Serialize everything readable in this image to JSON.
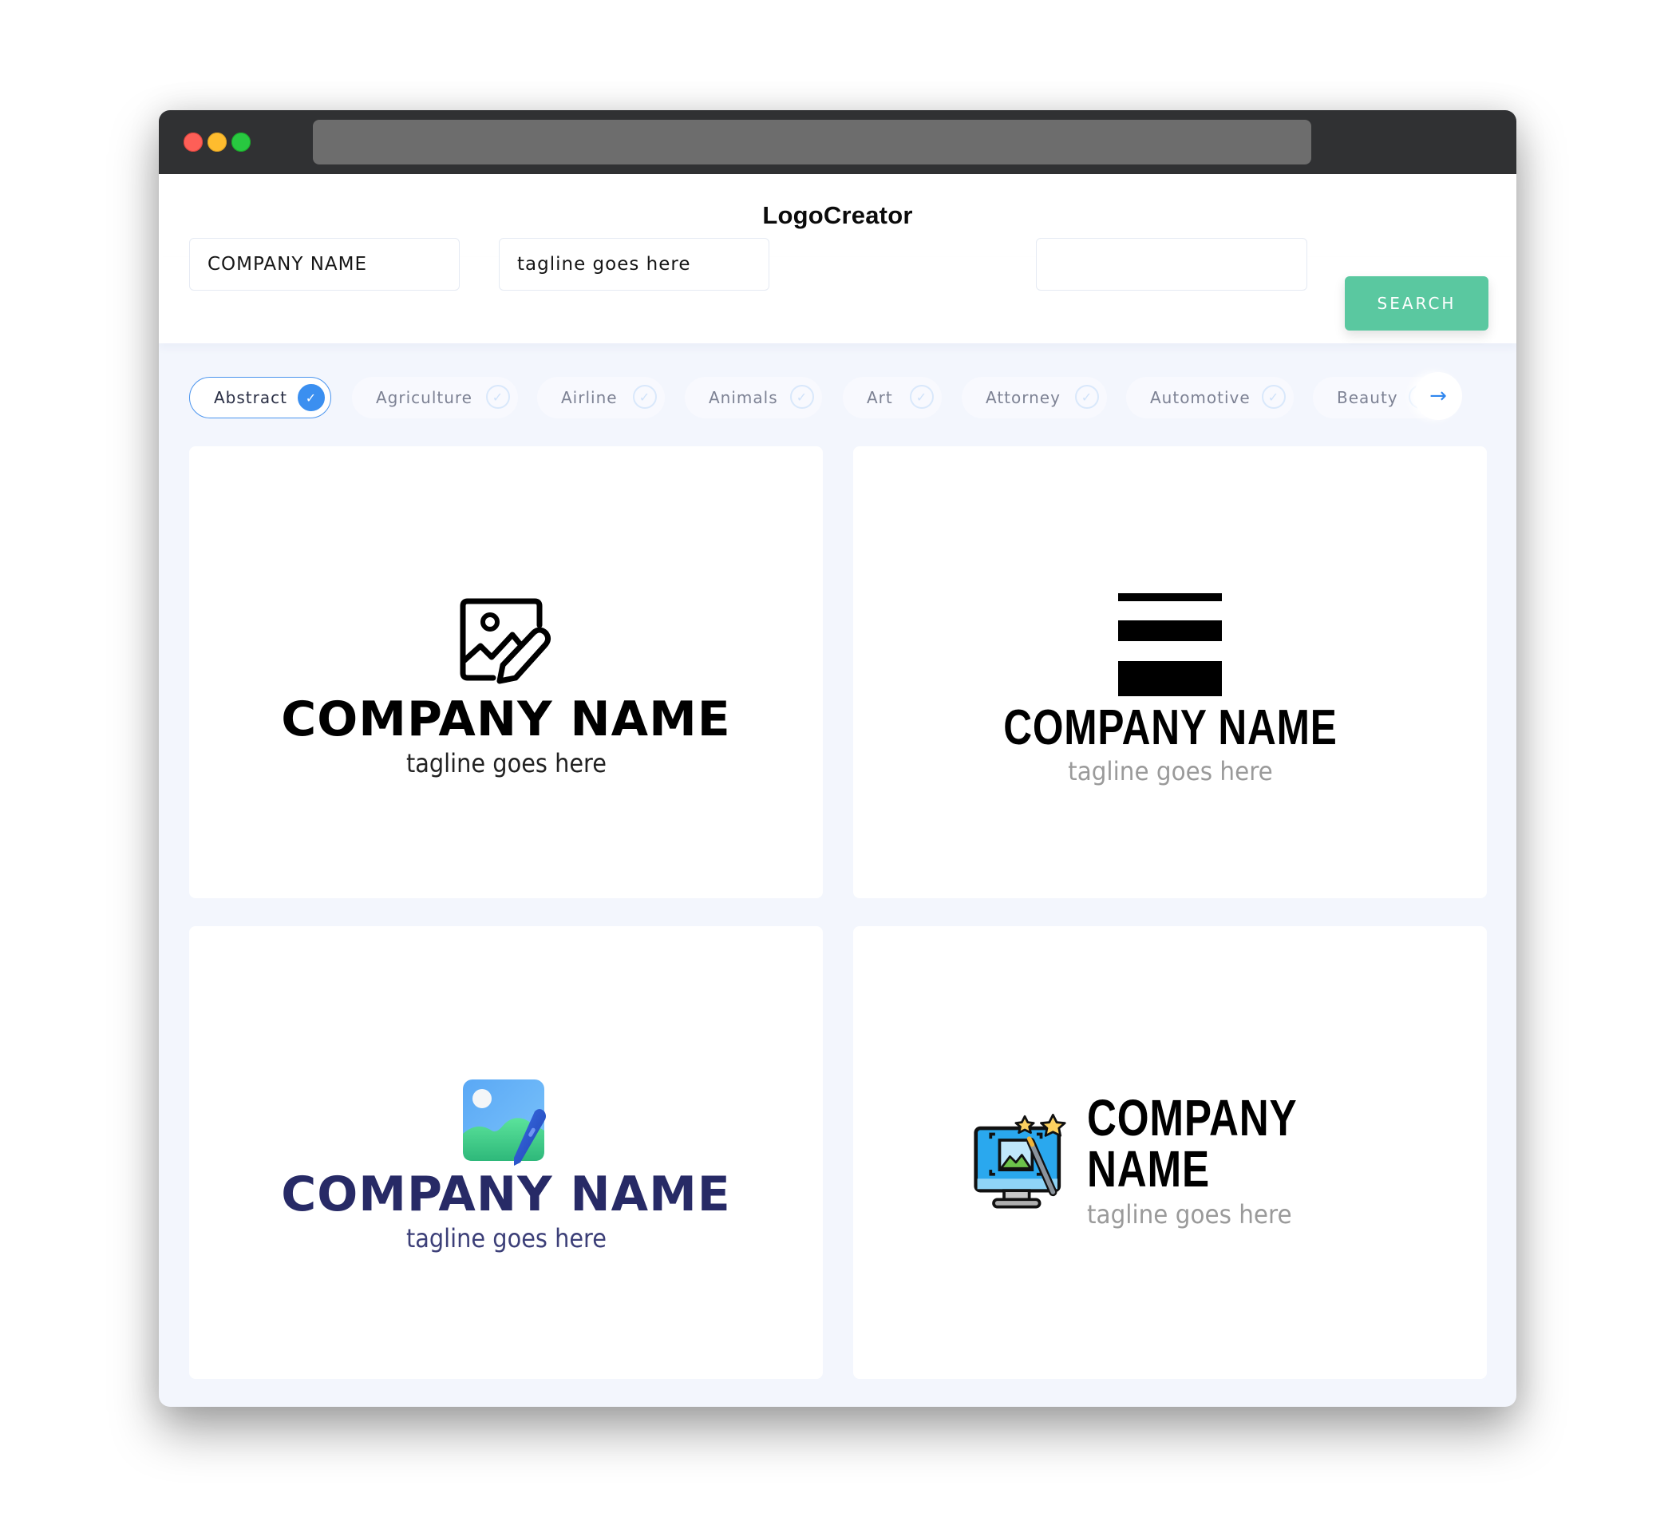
{
  "app": {
    "title": "LogoCreator"
  },
  "search": {
    "company_value": "COMPANY NAME",
    "tagline_value": "tagline goes here",
    "extra_value": "",
    "search_label": "SEARCH"
  },
  "categories": {
    "items": [
      {
        "label": "Abstract",
        "selected": true
      },
      {
        "label": "Agriculture",
        "selected": false
      },
      {
        "label": "Airline",
        "selected": false
      },
      {
        "label": "Animals",
        "selected": false
      },
      {
        "label": "Art",
        "selected": false
      },
      {
        "label": "Attorney",
        "selected": false
      },
      {
        "label": "Automotive",
        "selected": false
      },
      {
        "label": "Beauty",
        "selected": false
      }
    ],
    "next_icon": "arrow-right-icon"
  },
  "logos": [
    {
      "company": "COMPANY NAME",
      "tagline": "tagline goes here",
      "icon": "image-edit-outline-icon",
      "name_color": "#000000",
      "tagline_color": "#222222"
    },
    {
      "company": "COMPANY NAME",
      "tagline": "tagline goes here",
      "icon": "stacked-bars-icon",
      "name_color": "#000000",
      "tagline_color": "#9a9a9a"
    },
    {
      "company": "COMPANY NAME",
      "tagline": "tagline goes here",
      "icon": "image-edit-gradient-icon",
      "name_color": "#272a66",
      "tagline_color": "#3c3f78"
    },
    {
      "company": "COMPANY NAME",
      "tagline": "tagline goes here",
      "icon": "monitor-image-magic-wand-icon",
      "name_color": "#000000",
      "tagline_color": "#9a9a9a"
    }
  ],
  "colors": {
    "accent": "#3b8ff0",
    "search_button": "#5ac8a0",
    "titlebar": "#303133",
    "page_bg": "#f3f6fd"
  }
}
